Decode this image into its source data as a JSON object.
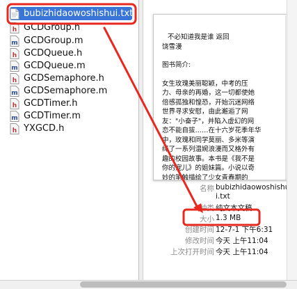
{
  "files": [
    {
      "name": "bubizhidaowoshishui.txt",
      "kind": "txt",
      "selected": true
    },
    {
      "name": "GCDGroup.h",
      "kind": "h"
    },
    {
      "name": "GCDGroup.m",
      "kind": "m"
    },
    {
      "name": "GCDQueue.h",
      "kind": "h"
    },
    {
      "name": "GCDQueue.m",
      "kind": "m"
    },
    {
      "name": "GCDSemaphore.h",
      "kind": "h"
    },
    {
      "name": "GCDSemaphore.m",
      "kind": "m"
    },
    {
      "name": "GCDTimer.h",
      "kind": "h"
    },
    {
      "name": "GCDTimer.m",
      "kind": "m"
    },
    {
      "name": "YXGCD.h",
      "kind": "h"
    }
  ],
  "icons": {
    "h": "header-file-icon",
    "m": "implementation-file-icon",
    "txt": "text-file-icon"
  },
  "preview": {
    "lines": [
      "不必知道我是谁  返回",
      "饶雪漫",
      "",
      "图书简介:",
      "",
      "女生玫瑰美丽聪颖，中考的压",
      "力、母亲的再婚，这一切都使她",
      "倍感孤独和惶恐，开始沉迷网络",
      "世界寻求安慰，由此邂逅了网",
      "友：\"小奋子\"，并陷入虚幻的网",
      "恋不能自拔……在十六岁花季年华",
      "中，玫瑰和同学莫丽、多米等演",
      "绎了一系列温婉浪漫而又格外有",
      "趣的校园故事。本书是《我不是",
      "你的宠儿》的姐妹篇。小说以奇",
      "妙的笔触描绘了少女青春期的"
    ]
  },
  "info": {
    "name_label": "名称",
    "name_value_1": "bubizhidaowoshishu",
    "name_value_2": "i.txt",
    "kind_label": "种类",
    "kind_value": "纯文本文稿",
    "size_label": "大小",
    "size_value": "1.3 MB",
    "created_label": "创建时间",
    "created_value": "12-7-1 下午6:31",
    "modified_label": "修改时间",
    "modified_value": "今天 上午11:04",
    "opened_label": "上次打开时间",
    "opened_value": "今天 上午11:04"
  },
  "colors": {
    "selection": "#3875d7",
    "annotation": "#e8281e"
  }
}
